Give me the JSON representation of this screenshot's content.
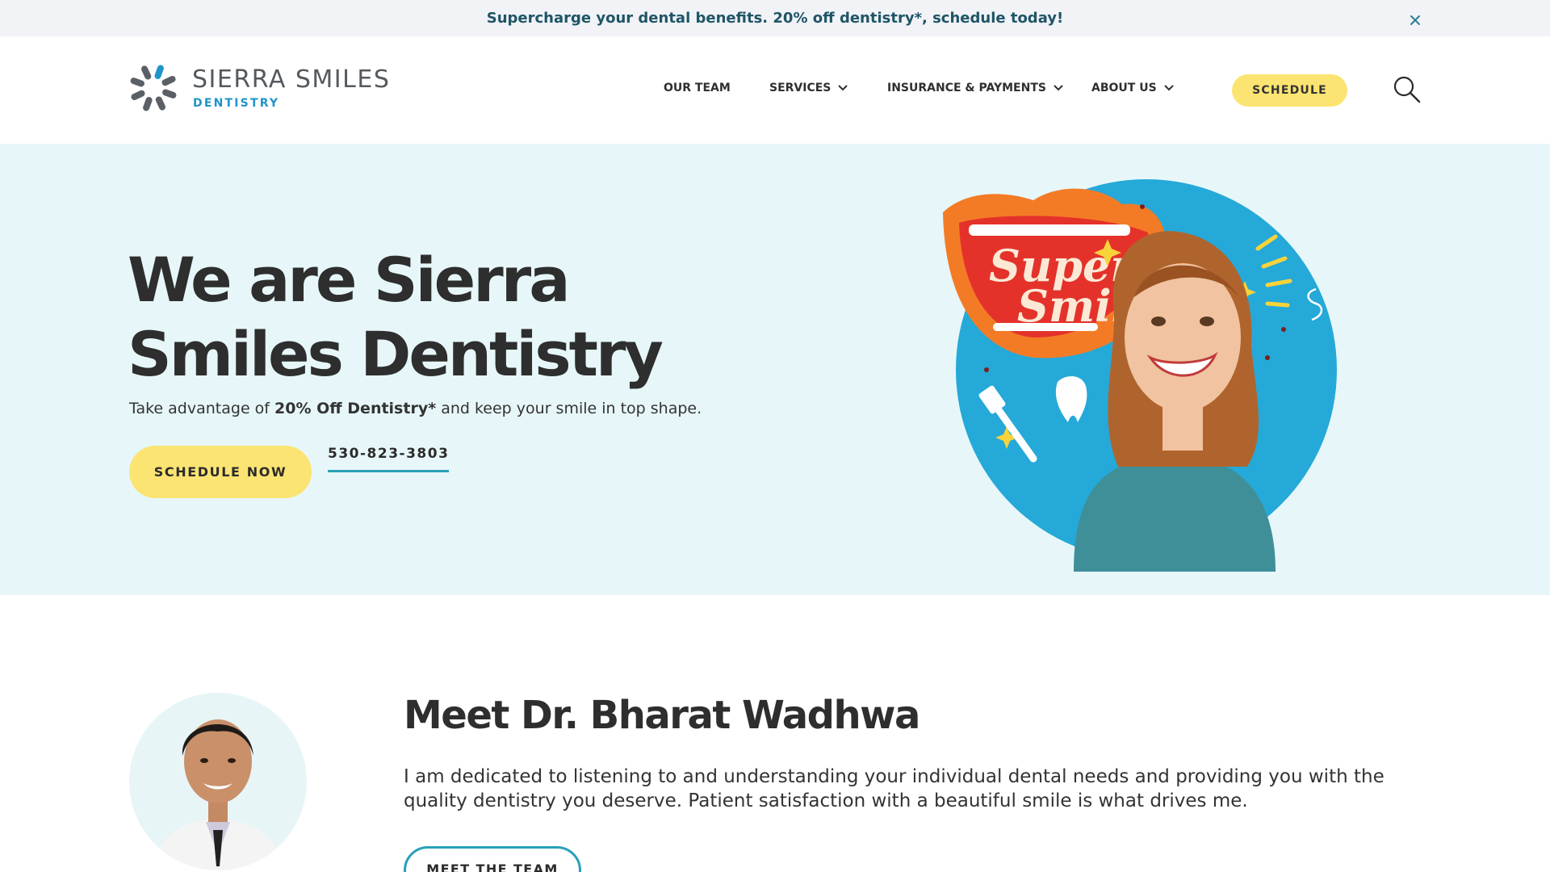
{
  "announcement": {
    "text": "Supercharge your dental benefits. 20% off dentistry*, schedule today!",
    "close_icon": "close-icon"
  },
  "brand": {
    "name": "SIERRA SMILES",
    "sub": "DENTISTRY",
    "primary_color": "#1f95c8",
    "mark_color": "#5a6066"
  },
  "nav": {
    "items": [
      {
        "label": "OUR TEAM",
        "has_dropdown": false
      },
      {
        "label": "SERVICES",
        "has_dropdown": true
      },
      {
        "label": "INSURANCE & PAYMENTS",
        "has_dropdown": true
      },
      {
        "label": "ABOUT US",
        "has_dropdown": true
      }
    ],
    "schedule_label": "SCHEDULE",
    "search_icon": "search-icon"
  },
  "hero": {
    "title": "We are Sierra Smiles Dentistry",
    "sub_prefix": "Take advantage of ",
    "sub_bold": "20% Off Dentistry*",
    "sub_suffix": " and keep your smile in top shape.",
    "cta_label": "SCHEDULE NOW",
    "phone": "530-823-3803",
    "background_color": "#e7f7f9",
    "accent_color": "#fbe472",
    "illustration_text_1": "Super",
    "illustration_text_2": "Smile"
  },
  "doctor": {
    "title": "Meet Dr. Bharat Wadhwa",
    "text": "I am dedicated to listening to and understanding your individual dental needs and providing you with the quality dentistry you deserve. Patient satisfaction with a beautiful smile is what drives me.",
    "cta_label": "MEET THE TEAM",
    "outline_color": "#2aa0b8"
  }
}
